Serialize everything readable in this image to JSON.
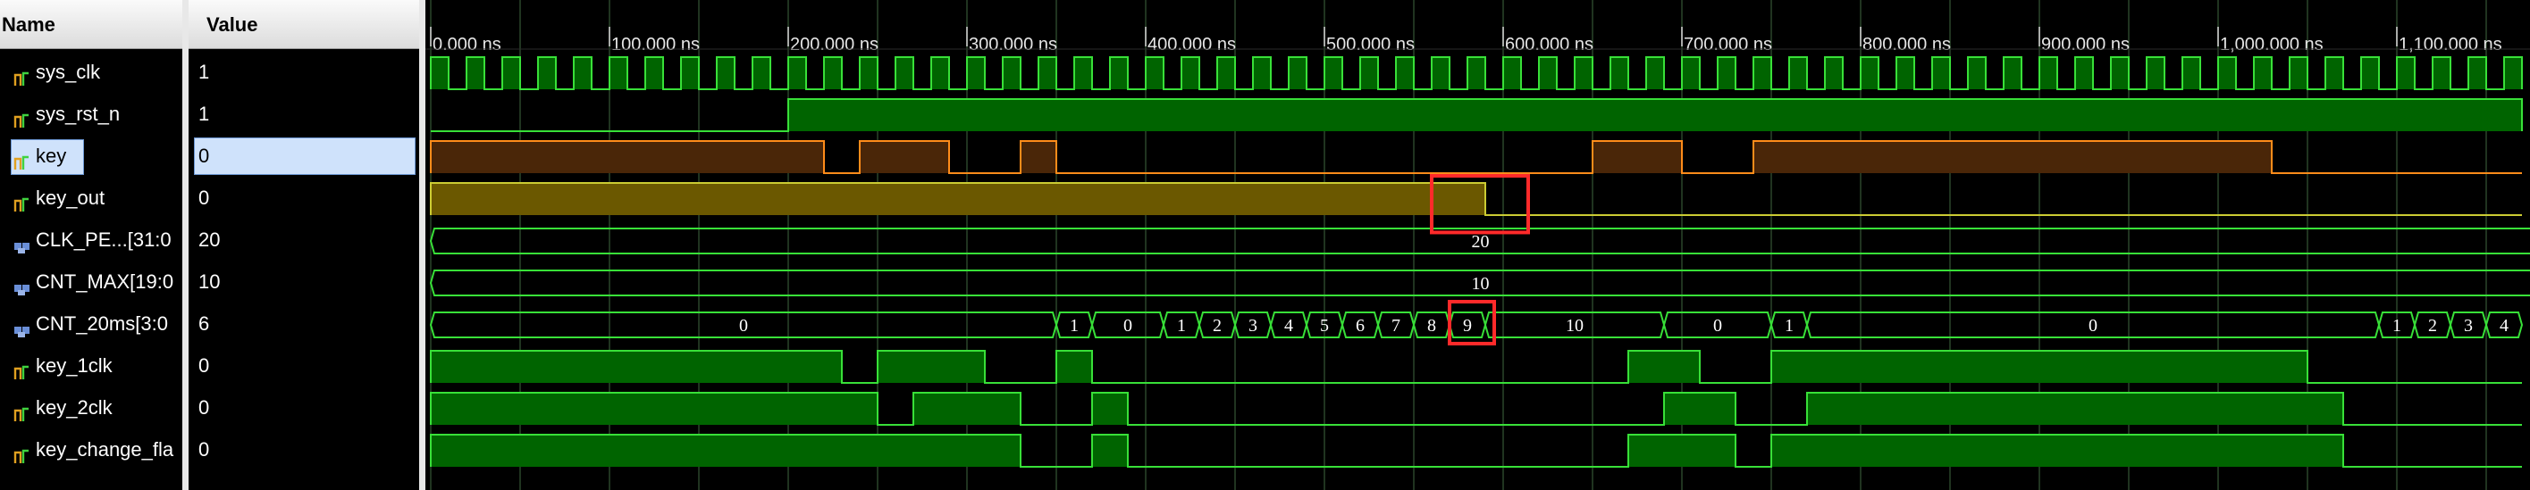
{
  "headers": {
    "name": "Name",
    "value": "Value"
  },
  "signals": [
    {
      "name": "sys_clk",
      "value": "1",
      "icon": "bit-signal-icon"
    },
    {
      "name": "sys_rst_n",
      "value": "1",
      "icon": "bit-signal-icon"
    },
    {
      "name": "key",
      "value": "0",
      "icon": "bit-signal-icon",
      "selected": true
    },
    {
      "name": "key_out",
      "value": "0",
      "icon": "bit-signal-icon"
    },
    {
      "name": "CLK_PE...[31:0",
      "value": "20",
      "icon": "bus-signal-icon"
    },
    {
      "name": "CNT_MAX[19:0",
      "value": "10",
      "icon": "bus-signal-icon"
    },
    {
      "name": "CNT_20ms[3:0",
      "value": "6",
      "icon": "bus-signal-icon"
    },
    {
      "name": "key_1clk",
      "value": "0",
      "icon": "bit-signal-icon"
    },
    {
      "name": "key_2clk",
      "value": "0",
      "icon": "bit-signal-icon"
    },
    {
      "name": "key_change_fla",
      "value": "0",
      "icon": "bit-signal-icon"
    }
  ],
  "timeline": {
    "time_labels": [
      "0.000 ns",
      "100.000 ns",
      "200.000 ns",
      "300.000 ns",
      "400.000 ns",
      "500.000 ns",
      "600.000 ns",
      "700.000 ns",
      "800.000 ns",
      "900.000 ns",
      "1,000.000 ns",
      "1,100.000 ns"
    ],
    "visible_end_ns": 1170,
    "clock_period_ns": 20
  },
  "waves": {
    "sys_rst_n": {
      "high_from_ns": 200
    },
    "key": {
      "high_intervals_ns": [
        [
          0,
          220
        ],
        [
          240,
          290
        ],
        [
          330,
          350
        ],
        [
          650,
          700
        ],
        [
          740,
          1030
        ]
      ]
    },
    "key_out": {
      "high_intervals_ns": [
        [
          0,
          590
        ]
      ]
    },
    "CLK_PE": {
      "value": "20"
    },
    "CNT_MAX": {
      "value": "10"
    },
    "CNT_20ms": [
      {
        "start": 0,
        "end": 350,
        "label": "0"
      },
      {
        "start": 350,
        "end": 370,
        "label": "1"
      },
      {
        "start": 370,
        "end": 410,
        "label": "0"
      },
      {
        "start": 410,
        "end": 430,
        "label": "1"
      },
      {
        "start": 430,
        "end": 450,
        "label": "2"
      },
      {
        "start": 450,
        "end": 470,
        "label": "3"
      },
      {
        "start": 470,
        "end": 490,
        "label": "4"
      },
      {
        "start": 490,
        "end": 510,
        "label": "5"
      },
      {
        "start": 510,
        "end": 530,
        "label": "6"
      },
      {
        "start": 530,
        "end": 550,
        "label": "7"
      },
      {
        "start": 550,
        "end": 570,
        "label": "8"
      },
      {
        "start": 570,
        "end": 590,
        "label": "9"
      },
      {
        "start": 590,
        "end": 690,
        "label": "10"
      },
      {
        "start": 690,
        "end": 750,
        "label": "0"
      },
      {
        "start": 750,
        "end": 770,
        "label": "1"
      },
      {
        "start": 770,
        "end": 1090,
        "label": "0"
      },
      {
        "start": 1090,
        "end": 1110,
        "label": "1"
      },
      {
        "start": 1110,
        "end": 1130,
        "label": "2"
      },
      {
        "start": 1130,
        "end": 1150,
        "label": "3"
      },
      {
        "start": 1150,
        "end": 1170,
        "label": "4"
      }
    ],
    "key_1clk": {
      "high_intervals_ns": [
        [
          0,
          230
        ],
        [
          250,
          310
        ],
        [
          350,
          370
        ],
        [
          670,
          710
        ],
        [
          750,
          1050
        ]
      ]
    },
    "key_2clk": {
      "high_intervals_ns": [
        [
          0,
          250
        ],
        [
          270,
          330
        ],
        [
          370,
          390
        ],
        [
          690,
          730
        ],
        [
          770,
          1070
        ]
      ]
    },
    "key_change_flag": {
      "high_intervals_ns": [
        [
          0,
          330
        ],
        [
          370,
          390
        ],
        [
          670,
          730
        ],
        [
          750,
          1070
        ]
      ]
    }
  },
  "highlights": [
    {
      "name": "key-out-fall-highlight",
      "t0_ns": 560,
      "t1_ns": 614,
      "row": 3,
      "span": 1.35
    },
    {
      "name": "cnt-nine-highlight",
      "t0_ns": 570,
      "t1_ns": 595,
      "row": 6,
      "span": 1.0
    }
  ],
  "colors": {
    "bit_fill": "#006400",
    "bit_line": "#38e038",
    "key_fill": "#4a2608",
    "key_line": "#ff8c1a",
    "keyout_fill": "#6b5800",
    "keyout_line": "#cccc33",
    "bus_line": "#38e038",
    "grid": "#2d4a2d",
    "highlight": "#ff2a2a"
  }
}
